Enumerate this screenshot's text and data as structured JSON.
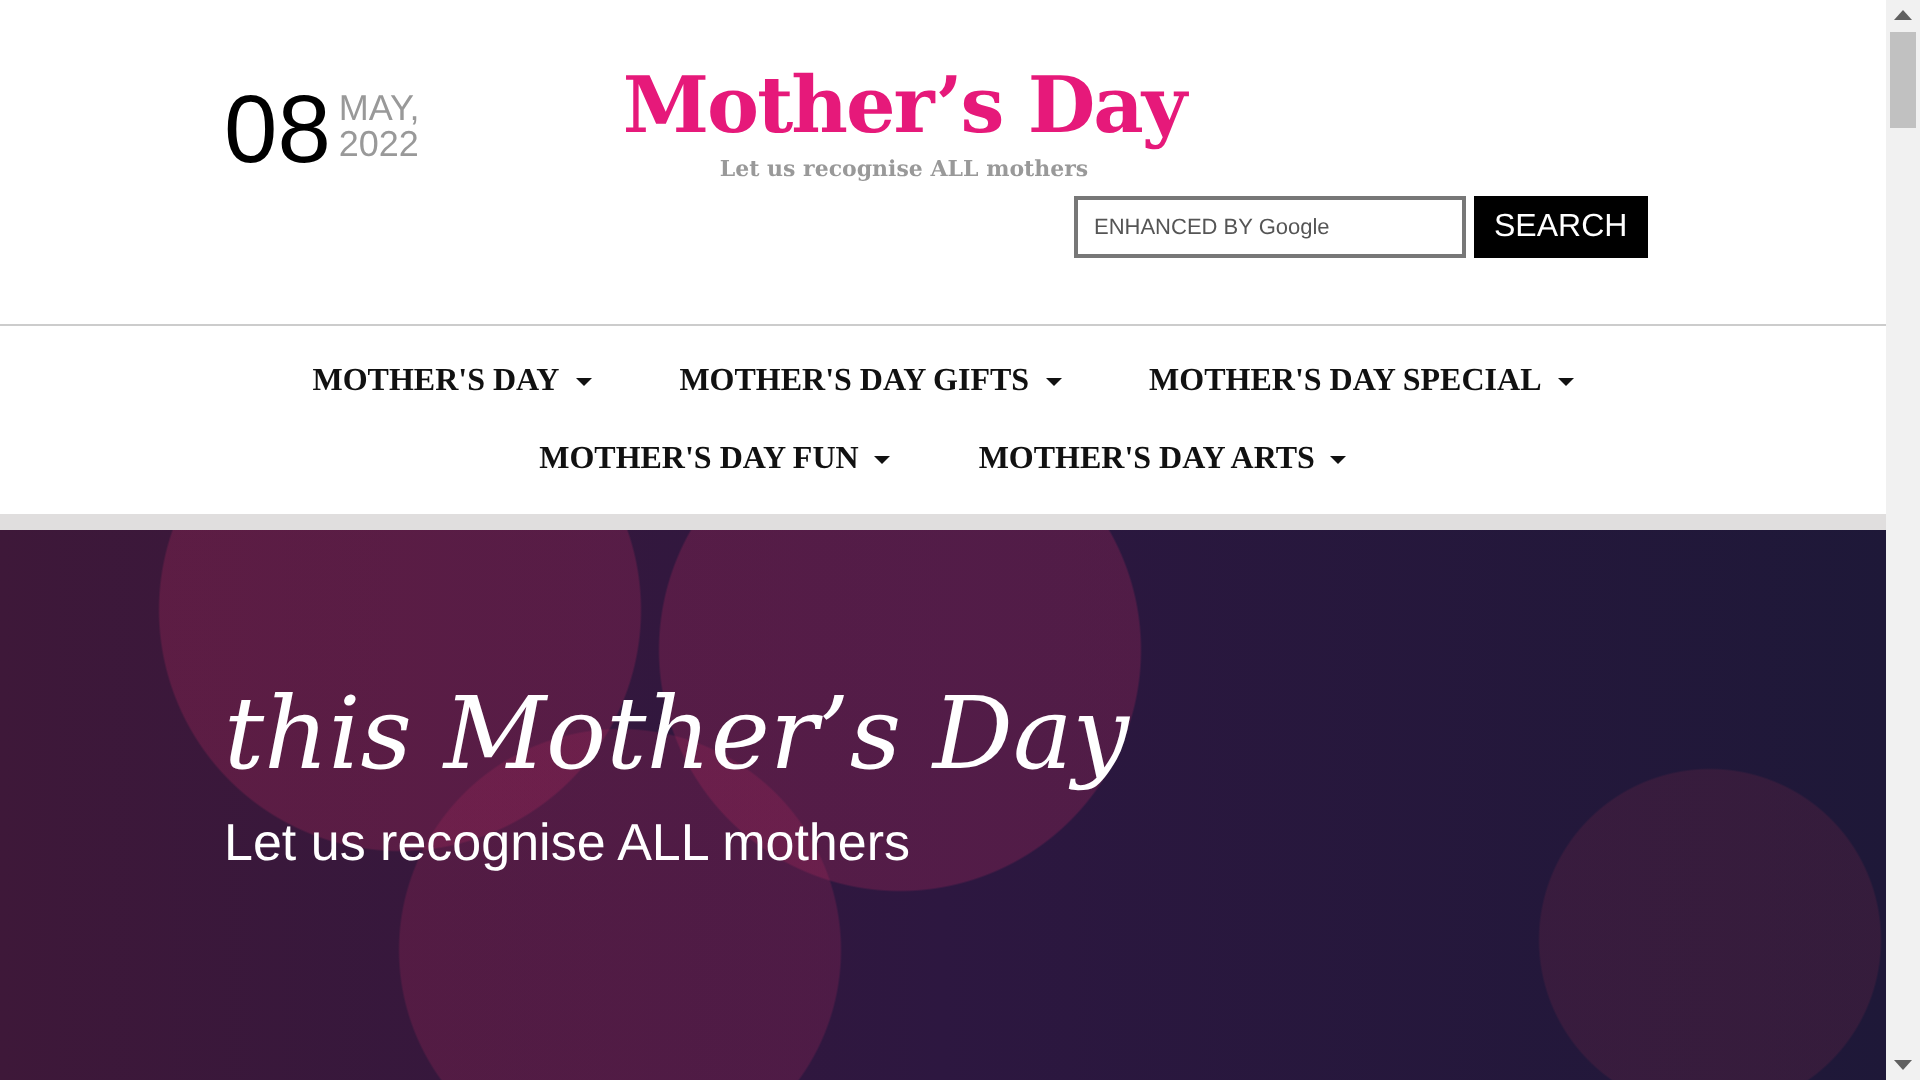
{
  "date": {
    "day": "08",
    "month": "MAY,",
    "year": "2022"
  },
  "logo": {
    "title": "Mother’s Day",
    "tagline": "Let us recognise ALL mothers"
  },
  "search": {
    "placeholder": "ENHANCED BY Google",
    "button": "SEARCH"
  },
  "nav": [
    {
      "label": "MOTHER'S DAY"
    },
    {
      "label": "MOTHER'S DAY GIFTS"
    },
    {
      "label": "MOTHER'S DAY SPECIAL"
    },
    {
      "label": "MOTHER'S DAY FUN"
    },
    {
      "label": "MOTHER'S DAY ARTS"
    }
  ],
  "hero": {
    "title": "this Mother’s Day",
    "subtitle": "Let us recognise ALL mothers"
  }
}
